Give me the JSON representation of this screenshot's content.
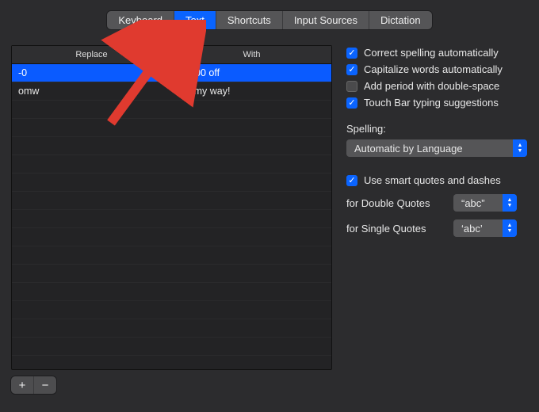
{
  "tabs": [
    "Keyboard",
    "Text",
    "Shortcuts",
    "Input Sources",
    "Dictation"
  ],
  "active_tab_index": 1,
  "table": {
    "headers": {
      "replace": "Replace",
      "with": "With"
    },
    "rows": [
      {
        "replace": "-0",
        "with": "- $300 off",
        "selected": true
      },
      {
        "replace": "omw",
        "with": "On my way!",
        "selected": false
      }
    ],
    "empty_rows": 15
  },
  "buttons": {
    "add": "+",
    "remove": "−"
  },
  "options": {
    "correct_spelling": {
      "label": "Correct spelling automatically",
      "checked": true
    },
    "capitalize": {
      "label": "Capitalize words automatically",
      "checked": true
    },
    "double_space_period": {
      "label": "Add period with double-space",
      "checked": false
    },
    "touch_bar": {
      "label": "Touch Bar typing suggestions",
      "checked": true
    },
    "spelling_label": "Spelling:",
    "spelling_select": "Automatic by Language",
    "smart_quotes": {
      "label": "Use smart quotes and dashes",
      "checked": true
    },
    "double_quotes_label": "for Double Quotes",
    "double_quotes_value": "“abc”",
    "single_quotes_label": "for Single Quotes",
    "single_quotes_value": "‘abc’"
  }
}
